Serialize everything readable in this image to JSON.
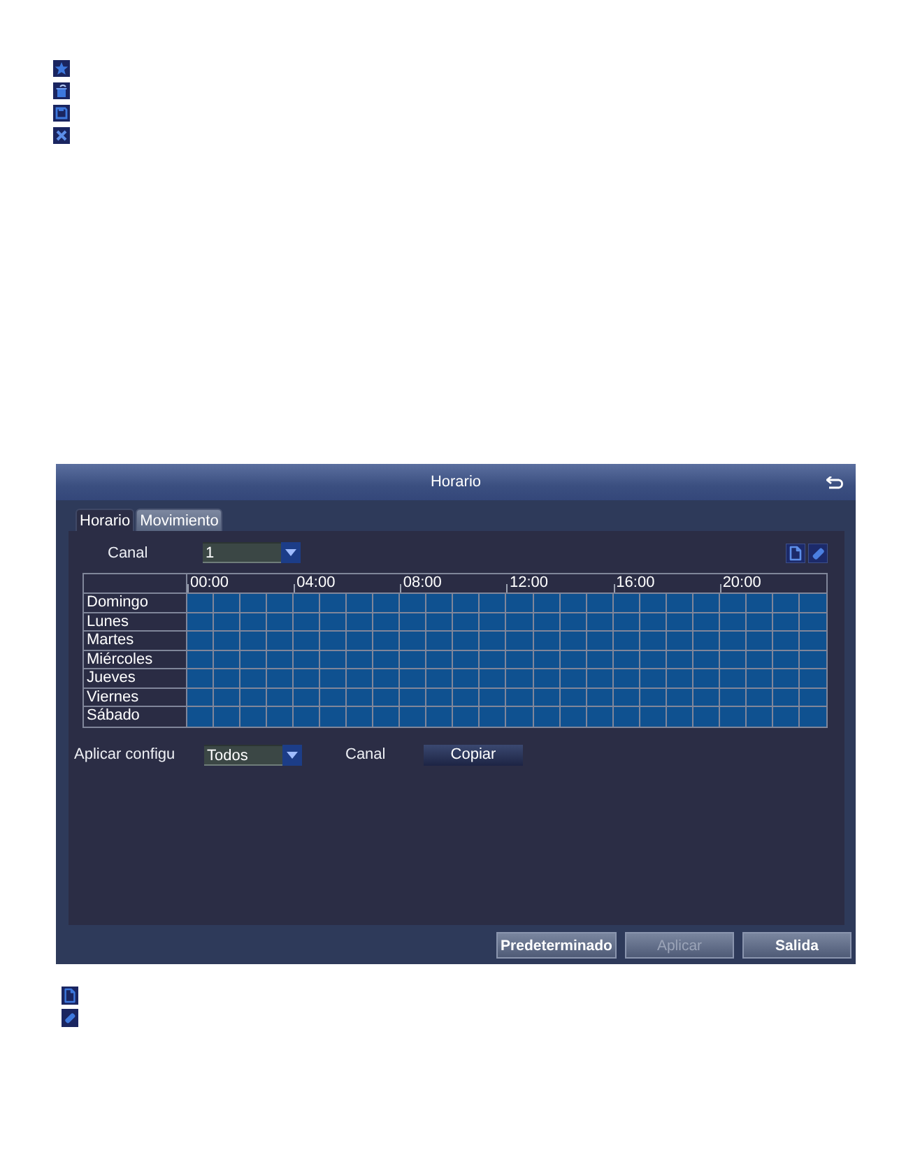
{
  "dialog": {
    "title": "Horario"
  },
  "tabs": [
    {
      "label": "Horario",
      "selected": true
    },
    {
      "label": "Movimiento",
      "selected": false
    }
  ],
  "channel": {
    "label": "Canal",
    "value": "1"
  },
  "schedule": {
    "hours": [
      "00:00",
      "04:00",
      "08:00",
      "12:00",
      "16:00",
      "20:00"
    ],
    "rows": [
      {
        "day": "Domingo",
        "slots": [
          true,
          true,
          true,
          true,
          true,
          true,
          true,
          true,
          true,
          true,
          true,
          true,
          true,
          true,
          true,
          true,
          true,
          true,
          true,
          true,
          true,
          true,
          true,
          true
        ]
      },
      {
        "day": "Lunes",
        "slots": [
          true,
          true,
          true,
          true,
          true,
          true,
          true,
          true,
          true,
          true,
          true,
          true,
          true,
          true,
          true,
          true,
          true,
          true,
          true,
          true,
          true,
          true,
          true,
          true
        ]
      },
      {
        "day": "Martes",
        "slots": [
          true,
          true,
          true,
          true,
          true,
          true,
          true,
          true,
          true,
          true,
          true,
          true,
          true,
          true,
          true,
          true,
          true,
          true,
          true,
          true,
          true,
          true,
          true,
          true
        ]
      },
      {
        "day": "Miércoles",
        "slots": [
          true,
          true,
          true,
          true,
          true,
          true,
          true,
          true,
          true,
          true,
          true,
          true,
          true,
          true,
          true,
          true,
          true,
          true,
          true,
          true,
          true,
          true,
          true,
          true
        ]
      },
      {
        "day": "Jueves",
        "slots": [
          true,
          true,
          true,
          true,
          true,
          true,
          true,
          true,
          true,
          true,
          true,
          true,
          true,
          true,
          true,
          true,
          true,
          true,
          true,
          true,
          true,
          true,
          true,
          true
        ]
      },
      {
        "day": "Viernes",
        "slots": [
          true,
          true,
          true,
          true,
          true,
          true,
          true,
          true,
          true,
          true,
          true,
          true,
          true,
          true,
          true,
          true,
          true,
          true,
          true,
          true,
          true,
          true,
          true,
          true
        ]
      },
      {
        "day": "Sábado",
        "slots": [
          true,
          true,
          true,
          true,
          true,
          true,
          true,
          true,
          true,
          true,
          true,
          true,
          true,
          true,
          true,
          true,
          true,
          true,
          true,
          true,
          true,
          true,
          true,
          true
        ]
      }
    ]
  },
  "copy_row": {
    "label": "Aplicar configu",
    "value": "Todos",
    "target_label": "Canal",
    "button": "Copiar"
  },
  "buttons": [
    {
      "label": "Predeterminado",
      "disabled": false
    },
    {
      "label": "Aplicar",
      "disabled": true
    },
    {
      "label": "Salida",
      "disabled": false
    }
  ]
}
